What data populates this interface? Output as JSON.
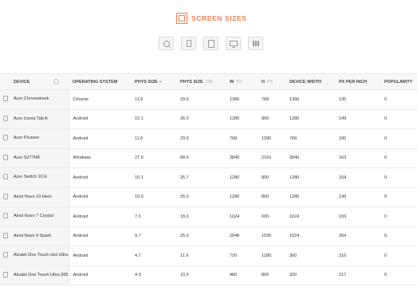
{
  "app": {
    "title": "SCREEN SIZES"
  },
  "filters": [
    "search-icon",
    "phone-icon",
    "tablet-icon",
    "desktop-icon",
    "grid-icon"
  ],
  "columns": [
    {
      "label": "DEVICE",
      "unit": ""
    },
    {
      "label": "OPERATING SYSTEM",
      "unit": ""
    },
    {
      "label": "PHYS SIZE",
      "unit": ""
    },
    {
      "label": "PHYS SIZE",
      "unit": "CM"
    },
    {
      "label": "W",
      "unit": "PX"
    },
    {
      "label": "H",
      "unit": "PX"
    },
    {
      "label": "DEVICE WIDTH",
      "unit": ""
    },
    {
      "label": "PX PER INCH",
      "unit": ""
    },
    {
      "label": "POPULARITY",
      "unit": ""
    }
  ],
  "rows": [
    [
      "Acer Chromebook",
      "Chrome",
      "11.6",
      "29.0",
      "1366",
      "768",
      "1366",
      "135",
      "0"
    ],
    [
      "Acer Iconia Tab A",
      "Android",
      "10.1",
      "26.0",
      "1280",
      "800",
      "1280",
      "149",
      "0"
    ],
    [
      "Acer Picasso",
      "Android",
      "11.6",
      "29.0",
      "768",
      "1280",
      "768",
      "190",
      "0"
    ],
    [
      "Acer S277HK",
      "Windows",
      "27.0",
      "68.6",
      "3840",
      "2160",
      "3840",
      "163",
      "0"
    ],
    [
      "Acer Switch 10 E",
      "Android",
      "10.1",
      "25.7",
      "1280",
      "800",
      "1280",
      "154",
      "0"
    ],
    [
      "Ainol Novo 10 Hero",
      "Android",
      "10.0",
      "25.0",
      "1280",
      "800",
      "1280",
      "149",
      "0"
    ],
    [
      "Ainol Novo 7 Crystal",
      "Android",
      "7.0",
      "18.0",
      "1024",
      "600",
      "1024",
      "169",
      "0"
    ],
    [
      "Ainol Novo 9 Spark",
      "Android",
      "9.7",
      "25.0",
      "2048",
      "1536",
      "1024",
      "264",
      "0"
    ],
    [
      "Alcatel One Touch Idol Ultra",
      "Android",
      "4.7",
      "11.9",
      "720",
      "1280",
      "360",
      "316",
      "0"
    ],
    [
      "Alcatel One Touch Ultra 995",
      "Android",
      "4.3",
      "10.9",
      "480",
      "800",
      "320",
      "217",
      "0"
    ]
  ]
}
